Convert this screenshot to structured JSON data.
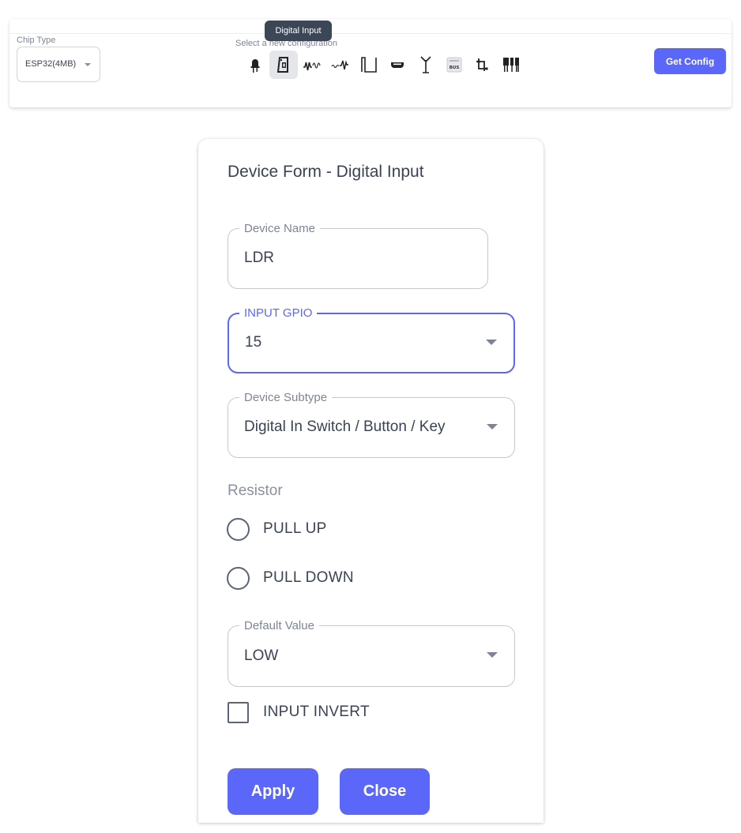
{
  "toolbar": {
    "chip_type_label": "Chip Type",
    "chip_type_value": "ESP32(4MB)",
    "config_label": "Select a new configuration",
    "tooltip": "Digital Input",
    "get_config_label": "Get Config",
    "icons": [
      {
        "name": "led-output-icon"
      },
      {
        "name": "digital-input-icon",
        "active": true
      },
      {
        "name": "analog-input-icon"
      },
      {
        "name": "sensor-wave-icon"
      },
      {
        "name": "pulse-icon"
      },
      {
        "name": "rgb-led-icon"
      },
      {
        "name": "antenna-icon"
      },
      {
        "name": "bus-icon"
      },
      {
        "name": "i2c-icon"
      },
      {
        "name": "relay-icon"
      }
    ]
  },
  "form": {
    "title": "Device Form - Digital Input",
    "device_name_label": "Device Name",
    "device_name_value": "LDR",
    "input_gpio_label": "INPUT GPIO",
    "input_gpio_value": "15",
    "device_subtype_label": "Device Subtype",
    "device_subtype_value": "Digital In Switch / Button / Key",
    "resistor_label": "Resistor",
    "resistor_options": [
      "PULL UP",
      "PULL DOWN"
    ],
    "default_value_label": "Default Value",
    "default_value_value": "LOW",
    "input_invert_label": "INPUT INVERT",
    "apply_label": "Apply",
    "close_label": "Close"
  },
  "colors": {
    "accent": "#5b67f8",
    "tooltip_bg": "#3b4656",
    "text": "#3a4353"
  }
}
